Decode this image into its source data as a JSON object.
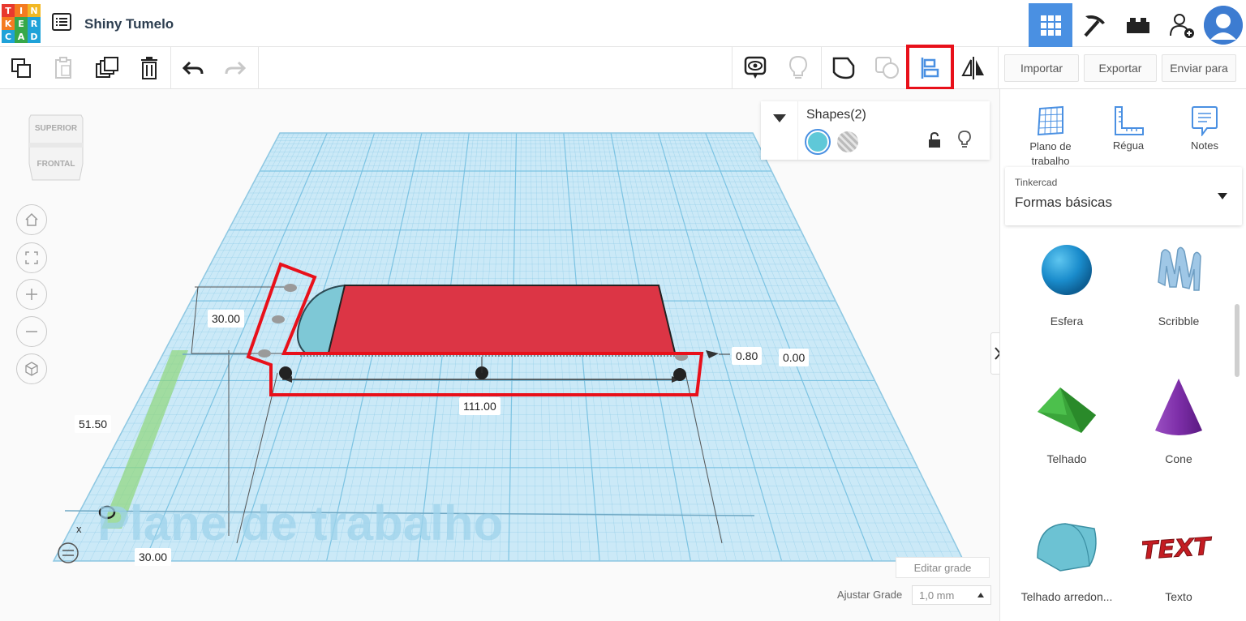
{
  "app": {
    "logo_letters": [
      "T",
      "I",
      "N",
      "K",
      "E",
      "R",
      "C",
      "A",
      "D"
    ],
    "logo_colors": [
      "#e8392e",
      "#f47b20",
      "#f2b824",
      "#f47b20",
      "#37a84a",
      "#1fa2d8",
      "#1fa2d8",
      "#37a84a",
      "#1fa2d8"
    ],
    "title": "Shiny Tumelo"
  },
  "header_icons": [
    "grid-view-icon",
    "pickaxe-icon",
    "brick-icon",
    "add-user-icon",
    "user-avatar"
  ],
  "toolbar": {
    "left_icons": [
      "copy-icon",
      "paste-icon",
      "duplicate-icon",
      "delete-icon",
      "undo-icon",
      "redo-icon"
    ],
    "right_icons": [
      "show-all-icon",
      "light-icon",
      "group-icon",
      "ungroup-icon",
      "align-icon",
      "mirror-icon"
    ],
    "import_label": "Importar",
    "export_label": "Exportar",
    "send_label": "Enviar para"
  },
  "viewcube": {
    "top": "SUPERIOR",
    "front": "FRONTAL"
  },
  "shapes_panel": {
    "title": "Shapes(2)"
  },
  "dimensions": {
    "height": "30.00",
    "width": "111.00",
    "elevation": "0.80",
    "offset": "0.00",
    "side": "51.50",
    "depth": "30.00"
  },
  "workplane_watermark": "Plane de trabalho",
  "right_tools": [
    {
      "label": "Plano de trabalho",
      "icon": "workplane-icon"
    },
    {
      "label": "Régua",
      "icon": "ruler-icon"
    },
    {
      "label": "Notes",
      "icon": "notes-icon"
    }
  ],
  "library": {
    "category": "Tinkercad",
    "selected": "Formas básicas"
  },
  "shapes": [
    {
      "label": "Esfera"
    },
    {
      "label": "Scribble"
    },
    {
      "label": "Telhado"
    },
    {
      "label": "Cone"
    },
    {
      "label": "Telhado arredon..."
    },
    {
      "label": "Texto"
    }
  ],
  "grid": {
    "edit_label": "Editar grade",
    "snap_label": "Ajustar Grade",
    "snap_value": "1,0 mm"
  },
  "colors": {
    "accent": "#4a90e2",
    "highlight": "#e8101a",
    "box": "#dc3545",
    "hole_shape": "#7ec8d6",
    "grid": "#b9dff0"
  }
}
